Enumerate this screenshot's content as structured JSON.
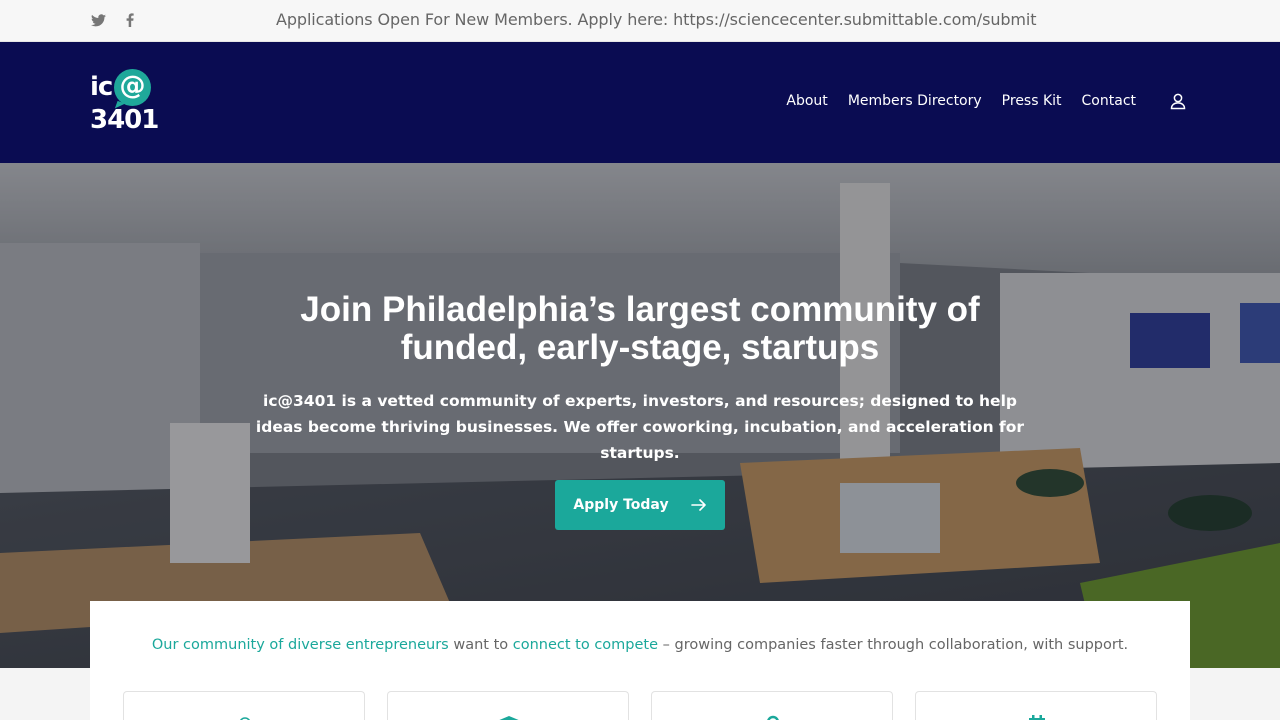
{
  "topbar": {
    "social": [
      {
        "name": "twitter-icon"
      },
      {
        "name": "facebook-icon"
      }
    ],
    "announcement": "Applications Open For New Members. Apply here: https://sciencecenter.submittable.com/submit"
  },
  "header": {
    "logo_text_top": "ic",
    "logo_at": "@",
    "logo_text_bottom": "3401",
    "nav": [
      {
        "label": "About"
      },
      {
        "label": "Members Directory"
      },
      {
        "label": "Press Kit"
      },
      {
        "label": "Contact"
      }
    ],
    "user_icon": "user-icon"
  },
  "hero": {
    "title": "Join Philadelphia’s largest community of funded, early-stage, startups",
    "subtitle": "ic@3401 is a vetted community of experts, investors, and resources; designed to help ideas become thriving businesses. We offer coworking, incubation, and acceleration for startups.",
    "cta_label": "Apply Today"
  },
  "intro": {
    "link1": "Our community of diverse entrepreneurs",
    "text1": " want to ",
    "link2": "connect to compete",
    "text2": " – growing companies faster through collaboration, with support."
  },
  "features": [
    {
      "icon": "lightbulb-icon"
    },
    {
      "icon": "graduation-cap-icon"
    },
    {
      "icon": "map-pin-icon"
    },
    {
      "icon": "calendar-icon"
    }
  ],
  "colors": {
    "header_bg": "#0a0c52",
    "accent": "#1ba89b",
    "topbar_bg": "#f7f7f7"
  }
}
